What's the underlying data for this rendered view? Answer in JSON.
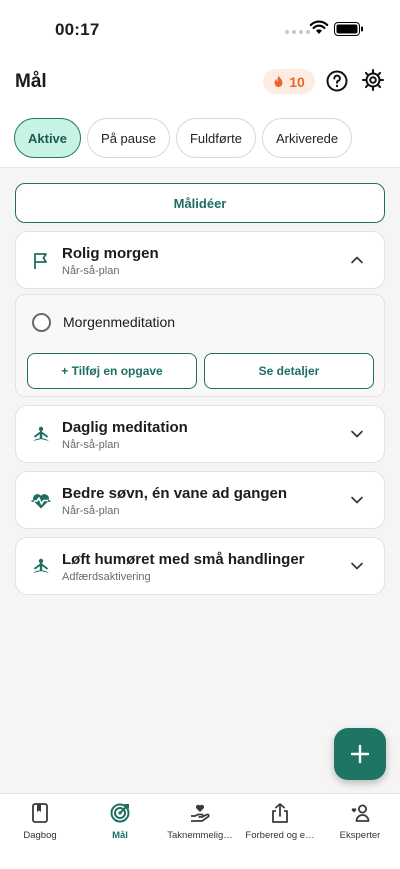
{
  "status_bar": {
    "time": "00:17"
  },
  "header": {
    "title": "Mål",
    "streak_count": "10"
  },
  "tabs": [
    {
      "label": "Aktive",
      "active": true
    },
    {
      "label": "På pause",
      "active": false
    },
    {
      "label": "Fuldførte",
      "active": false
    },
    {
      "label": "Arkiverede",
      "active": false
    }
  ],
  "ideas_button": "Målidéer",
  "goals": [
    {
      "title": "Rolig morgen",
      "subtitle": "Når-så-plan",
      "icon": "flag-icon",
      "expanded": true
    },
    {
      "title": "Daglig meditation",
      "subtitle": "Når-så-plan",
      "icon": "meditation-icon",
      "expanded": false
    },
    {
      "title": "Bedre søvn, én vane ad gangen",
      "subtitle": "Når-så-plan",
      "icon": "heart-pulse-icon",
      "expanded": false
    },
    {
      "title": "Løft humøret med små handlinger",
      "subtitle": "Adfærdsaktivering",
      "icon": "meditation-icon",
      "expanded": false
    }
  ],
  "expanded_goal": {
    "task": "Morgenmeditation",
    "add_task_label": "+ Tilføj en opgave",
    "details_label": "Se detaljer"
  },
  "bottom_nav": [
    {
      "label": "Dagbog",
      "icon": "book-icon",
      "active": false
    },
    {
      "label": "Mål",
      "icon": "target-icon",
      "active": true
    },
    {
      "label": "Taknemmelig…",
      "icon": "hand-heart-icon",
      "active": false
    },
    {
      "label": "Forbered og e…",
      "icon": "share-icon",
      "active": false
    },
    {
      "label": "Eksperter",
      "icon": "experts-icon",
      "active": false
    }
  ],
  "colors": {
    "accent": "#1e6f61",
    "active_tab_bg": "#c8f2e3",
    "streak": "#e8672a",
    "fab": "#1f7565"
  }
}
